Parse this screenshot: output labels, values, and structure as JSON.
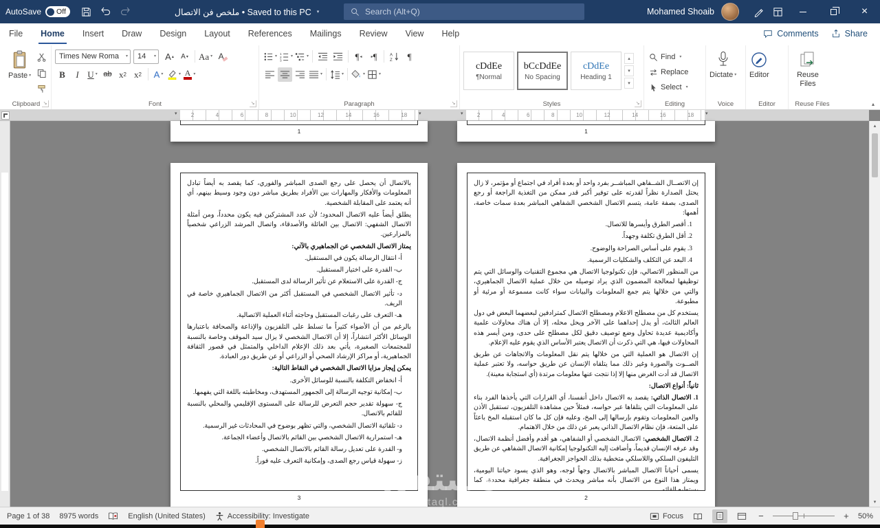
{
  "titlebar": {
    "autosave_label": "AutoSave",
    "autosave_state": "Off",
    "doc_title": "ملخص فن الاتصال • Saved to this PC",
    "search_placeholder": "Search (Alt+Q)",
    "user_name": "Mohamed Shoaib"
  },
  "tabs": {
    "items": [
      {
        "label": "File"
      },
      {
        "label": "Home"
      },
      {
        "label": "Insert"
      },
      {
        "label": "Draw"
      },
      {
        "label": "Design"
      },
      {
        "label": "Layout"
      },
      {
        "label": "References"
      },
      {
        "label": "Mailings"
      },
      {
        "label": "Review"
      },
      {
        "label": "View"
      },
      {
        "label": "Help"
      }
    ],
    "comments_label": "Comments",
    "share_label": "Share"
  },
  "ribbon": {
    "paste_label": "Paste",
    "clipboard_label": "Clipboard",
    "font_name": "Times New Roma",
    "font_size": "14",
    "font_label": "Font",
    "paragraph_label": "Paragraph",
    "styles_label": "Styles",
    "styles": [
      {
        "preview": "cDdEe",
        "name": "¶Normal"
      },
      {
        "preview": "bCcDdEe",
        "name": "No Spacing"
      },
      {
        "preview": "cDdEe",
        "name": "Heading 1"
      }
    ],
    "find_label": "Find",
    "replace_label": "Replace",
    "select_label": "Select",
    "editing_label": "Editing",
    "dictate_label": "Dictate",
    "voice_label": "Voice",
    "editor_label": "Editor",
    "editor_group_label": "Editor",
    "reuse_button_label": "Reuse Files",
    "reuse_group_label": "Reuse Files"
  },
  "ruler": {
    "numbers": [
      "2",
      "4",
      "6",
      "8",
      "10",
      "12",
      "14",
      "16",
      "18"
    ]
  },
  "document": {
    "watermark_title": "مستقل",
    "watermark_sub": "mostaql.com",
    "top_left_page_number": "1",
    "top_right_page_number": "1",
    "left_page": {
      "number": "3",
      "blocks": [
        {
          "text": "بالاتصال أن يحصل على رجع الصدى المباشر والفوري، كما يقصد به أيضاً تبادل المعلومات والأفكار والمهارات بين الأفراد بطريق مباشر دون وجود وسيط بينهم، أي أنه يعتمد على المقابلة الشخصية."
        },
        {
          "text": "يطلق أيضاً عليه الاتصال المحدود؛ لأن عدد المشتركين فيه يكون محدداً، ومن أمثلة الاتصال الشفهي: الاتصال بين العائلة والأصدقاء، واتصال المرشد الزراعي شخصياً بالمزارعين."
        },
        {
          "text": "يمتاز الاتصال الشخصي عن الجماهيري بالآتي:"
        },
        {
          "text": "أ- انتقال الرسالة يكون في المستقبل."
        },
        {
          "text": "ب- القدرة على اختيار المستقبل."
        },
        {
          "text": "ج- القدرة على الاستعلام عن تأثير الرسالة لدى المستقبل."
        },
        {
          "text": "د- تأثير الاتصال الشخصي في المستقبل أكثر من الاتصال الجماهيري خاصة في الريف."
        },
        {
          "text": "هـ- التعرف على رغبات المستقبل وحاجته أثناء العملية الاتصالية."
        },
        {
          "text": "بالرغم من أن الأضواء كثيراً ما تسلط على التلفزيون والإذاعة والصحافة باعتبارها الوسائل الأكثر انتشاراً، إلا أن الاتصال الشخصي لا يزال سيد الموقف وخاصة بالنسبة للمجتمعات الصغيرة، يأتي بعد ذلك الإعلام الداخلي والمتمثل في قصور الثقافة الجماهيرية، أو مراكز الإرشاد الصحي أو الزراعي أو عن طريق دور العبادة."
        },
        {
          "text": "يمكن إيجاز مزايا الاتصال الشخصي في النقاط التالية:"
        },
        {
          "text": "أ- انخفاض التكلفة بالنسبة للوسائل الأخرى."
        },
        {
          "text": "ب- إمكانية توجيه الرسالة إلى الجمهور المستهدف، ومخاطبته باللغة التي يفهمها."
        },
        {
          "text": "ج- سهولة تقدير حجم التعرض للرسالة على المستوى الإقليمي والمحلي بالنسبة للقائم بالاتصال."
        },
        {
          "text": "د- تلقائية الاتصال الشخصي، والتي تظهر بوضوح في المحادثات غير الرسمية."
        },
        {
          "text": "هـ- استمرارية الاتصال الشخصي بين القائم بالاتصال وأعضاء الجماعة."
        },
        {
          "text": "و- القدرة على تعديل رسالة القائم بالاتصال الشخصي."
        },
        {
          "text": "ز- سهولة قياس رجع الصدى، وإمكانية التعرف عليه فوراً."
        }
      ]
    },
    "right_page": {
      "number": "2",
      "blocks": [
        {
          "text": "إن الاتصــال الشــفاهي المباشــر بفرد واحد أو بعدة أفراد في اجتماع أو مؤتمر، لا زال يحتل الصدارة نظراً لقدرته على توفير أكبر قدر ممكن من التغذية الراجعة أو رجع الصدى، بصفة عامة، يتسم الاتصال الشخصي الشفاهي المباشر بعدة سمات خاصة، أهمها:"
        },
        {
          "text": "1. أقصر الطرق وأيسرها للاتصال."
        },
        {
          "text": "2. أقل الطرق تكلفة وجهداً."
        },
        {
          "text": "3. يقوم على أساس الصراحة والوضوح."
        },
        {
          "text": "4. البعد عن التكلف والشكليات الرسمية."
        },
        {
          "text": "من المنظور الاتصالي، فإن تكنولوجيا الاتصال هي مجموع التقنيات والوسائل التي يتم توظيفها لمعالجة المضمون الذي يراد توصيله من خلال عملية الاتصال الجماهيري، والتي من خلالها يتم جمع المعلومات والبيانات سواء كانت مسموعة أو مرئية أو مطبوعة."
        },
        {
          "text": "يستخدم كل من مصطلح الاعلام ومصطلح الاتصال كمترادفين لبعضهما البعض في دول العالم الثالث، أو يدل إحداهما على الآخر ويحل محله، إلا أن هناك محاولات علمية وأكاديمية عديدة تحاول وضع توصيف دقيق لكل مصطلح على حدى، ومن أيسر هذه المحاولات فيها، هي التي ذكرت أن الاتصال يعتبر الأساس الذي يقوم عليه الإعلام."
        },
        {
          "text": "إن الاتصال هو العملية التي من خلالها يتم نقل المعلومات والاتجاهات عن طريق الصــوت والصورة وغير ذلك مما يتلقاه الإنسان عن طريق حواسه، ولا تعتبر عملية الاتصال قد أدت الغرض منها إلا إذا نتجت عنها معلومات مرتدة (أي استجابة معينة)."
        },
        {
          "text": "ثانياً: أنواع الاتصال:"
        },
        {
          "lead": "1. الاتصال الذاتي:",
          "text": "يقصد به الاتصال داخل أنفسنا، أي القرارات التي يأخذها الفرد بناء على المعلومات التي يتلقاها عبر حواسه، فمثلاً حين مشاهدة التلفزيون، تستقبل الأذن والعين المعلومات وتقوم بإرسالها إلى المخ، وعليه فإن كل ما كان استقبله المخ باعثاً على المتعة، فإن نظام الاتصال الذاتي يعبر عن ذلك من خلال الاهتمام."
        },
        {
          "lead": "2. الاتصال الشخصي:",
          "text": "الاتصال الشخصي أو الشفاهي، هو أقدم وأفضل أنظمة الاتصال، وقد عرفه الإنسان قديماً، وأضافت إليه التكنولوجيا إمكانية الاتصال الشفاهي عن طريق التليفون السلكي واللاسلكي متخطية بذلك الحواجز الجغرافية."
        },
        {
          "text": "يسمى أحياناً الاتصال المباشر بالاتصال وجهاً لوجه، وهو الذي يسود حياتنا اليومية، ويمتاز هذا النوع من الاتصال بأنه مباشر ويحدث في منطقة جغرافية محددة، كما يستطيع القائم"
        }
      ]
    }
  },
  "statusbar": {
    "page_label": "Page 1 of 38",
    "word_count": "8975 words",
    "language": "English (United States)",
    "accessibility": "Accessibility: Investigate",
    "focus_label": "Focus",
    "zoom_level": "50%"
  }
}
